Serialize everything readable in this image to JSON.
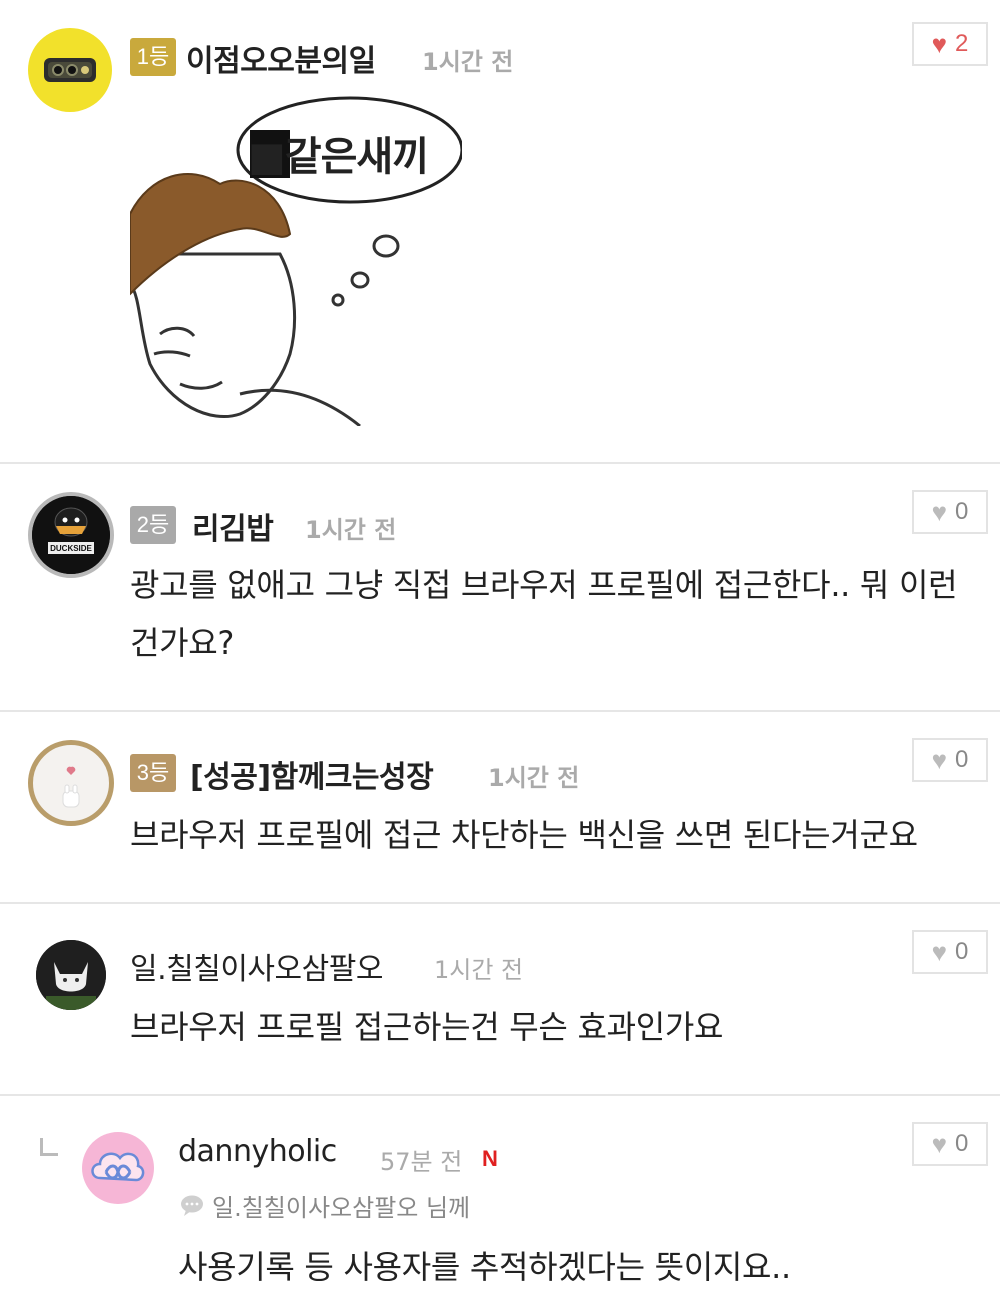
{
  "comments": [
    {
      "rank": "1등",
      "nickname": "이점오오분의일",
      "time": "1시간 전",
      "likes": "2",
      "sticker_text": "■같은새끼",
      "sticker_name": "meme-sticker-image"
    },
    {
      "rank": "2등",
      "nickname": "리김밥",
      "time": "1시간 전",
      "likes": "0",
      "avatar_text": "DUCKSIDE",
      "text": "광고를 없애고 그냥 직접 브라우저 프로필에 접근한다.. 뭐 이런건가요?"
    },
    {
      "rank": "3등",
      "nickname": "[성공]함께크는성장",
      "time": "1시간 전",
      "likes": "0",
      "text": "브라우저 프로필에 접근 차단하는 백신을 쓰면 된다는거군요"
    },
    {
      "nickname": "일.칠칠이사오삼팔오",
      "time": "1시간 전",
      "likes": "0",
      "text": "브라우저 프로필 접근하는건 무슨 효과인가요"
    },
    {
      "nickname": "dannyholic",
      "time": "57분 전",
      "new_badge": "N",
      "likes": "0",
      "reply_to": "일.칠칠이사오삼팔오 님께",
      "text": "사용기록 등 사용자를 추적하겠다는 뜻이지요.."
    }
  ],
  "colors": {
    "rank1": "#c9a93c",
    "rank2": "#a9a9a9",
    "rank3": "#b89766",
    "like_active": "#e05a5a",
    "divider": "#e6e6e6"
  },
  "icons": {
    "like": "heart-icon",
    "reply_indicator": "reply-arrow-icon",
    "reply_to": "speech-bubble-icon"
  }
}
